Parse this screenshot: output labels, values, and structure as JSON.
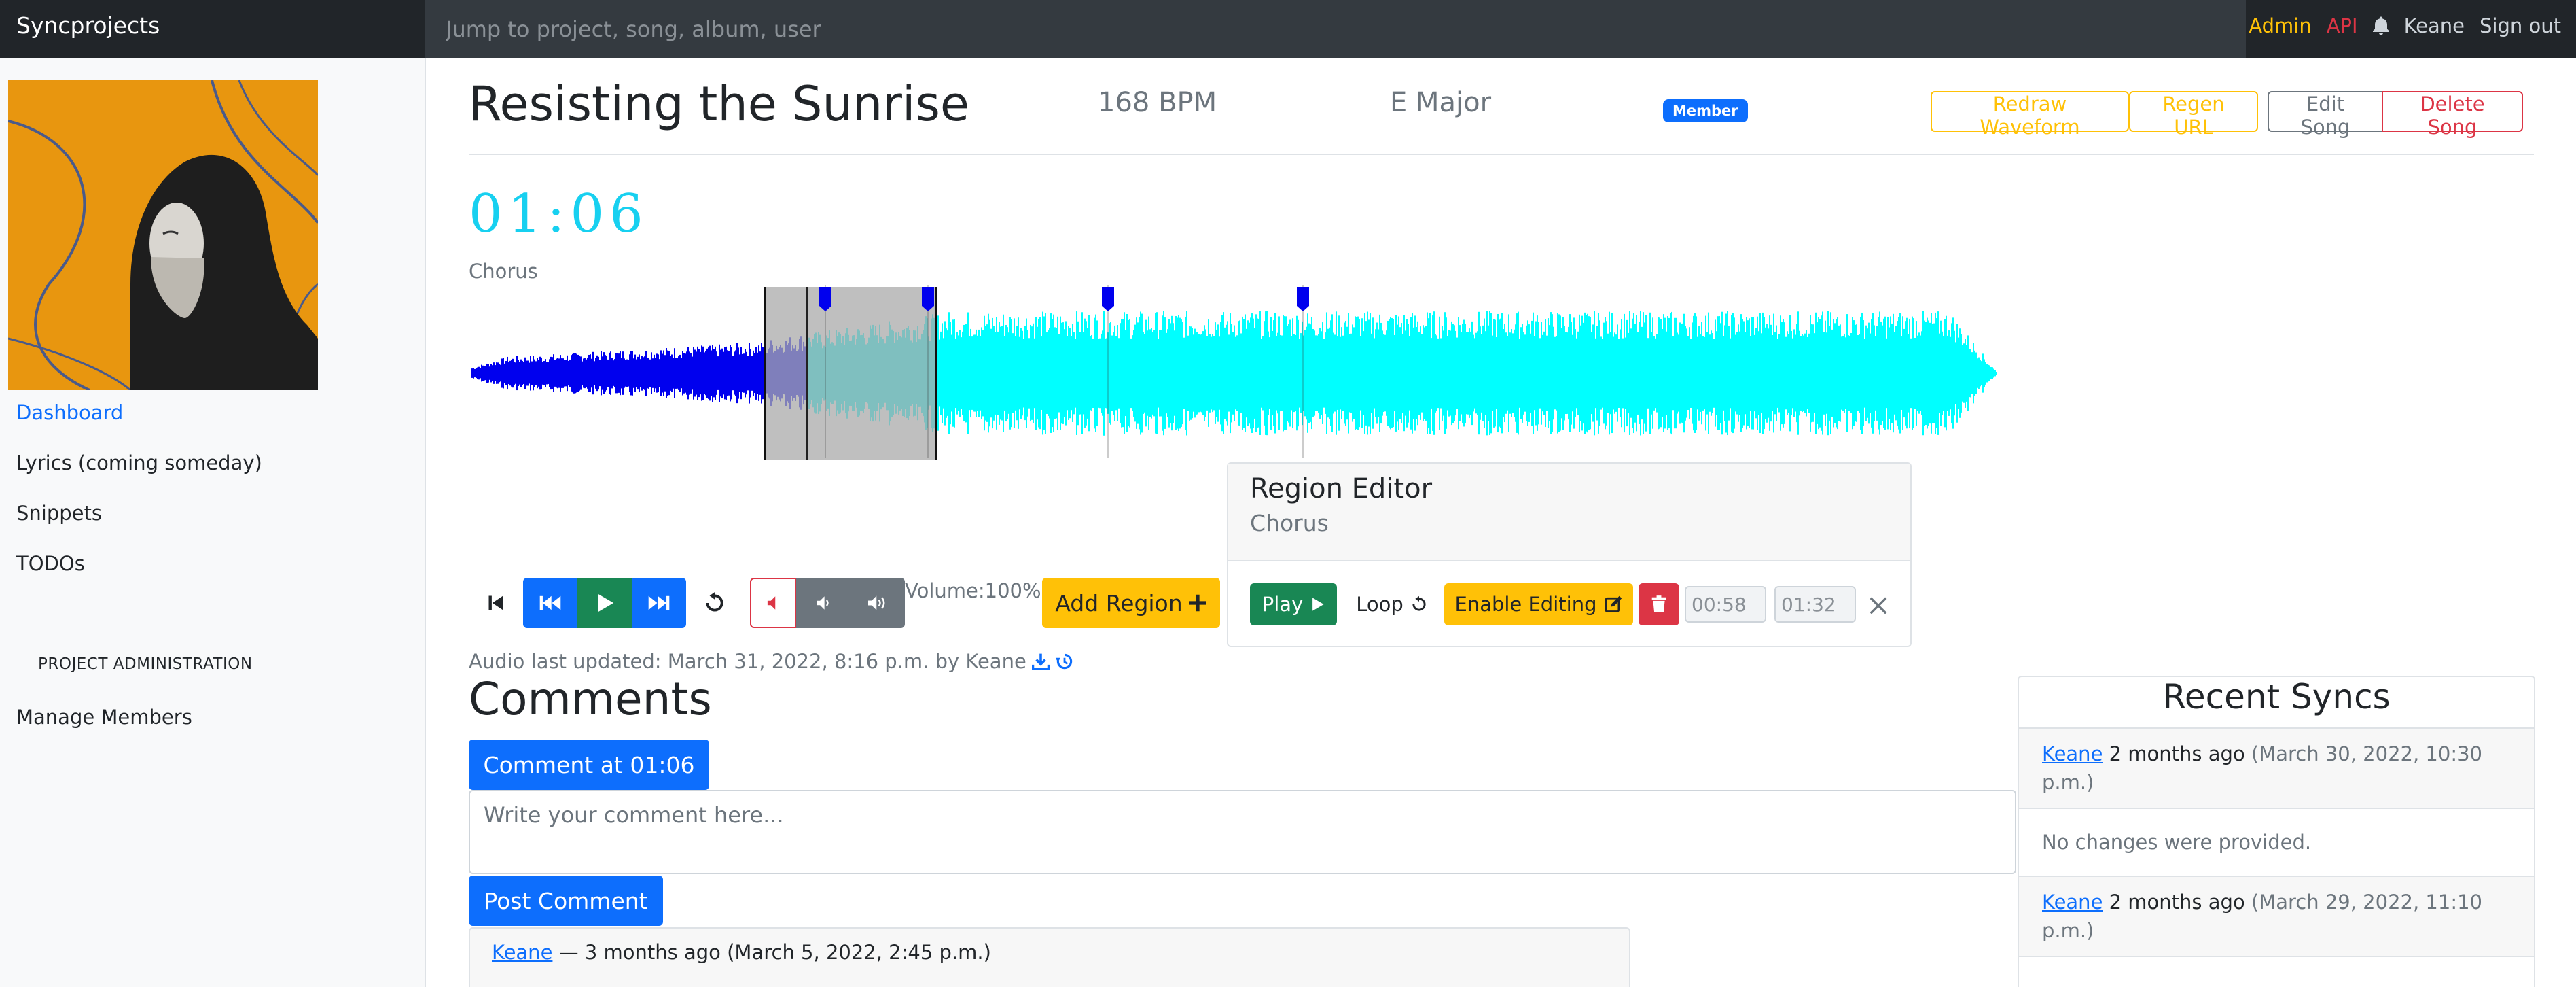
{
  "nav": {
    "brand": "Syncprojects",
    "search_placeholder": "Jump to project, song, album, user",
    "admin": "Admin",
    "api": "API",
    "user": "Keane",
    "signout": "Sign out"
  },
  "sidebar": {
    "items": [
      {
        "label": "Dashboard"
      },
      {
        "label": "Lyrics (coming someday)"
      },
      {
        "label": "Snippets"
      },
      {
        "label": "TODOs"
      }
    ],
    "section_heading": "PROJECT ADMINISTRATION",
    "admin_items": [
      {
        "label": "Manage Members"
      }
    ]
  },
  "song": {
    "title": "Resisting the Sunrise",
    "bpm": "168 BPM",
    "key": "E Major",
    "badge": "Member"
  },
  "actions": {
    "redraw": "Redraw Waveform",
    "regen": "Regen URL",
    "edit": "Edit Song",
    "delete": "Delete Song"
  },
  "player": {
    "time": "01:06",
    "current_region": "Chorus",
    "volume_label": "Volume:100%",
    "volume": 1.0,
    "add_region": "Add Region"
  },
  "region_editor": {
    "title": "Region Editor",
    "subtitle": "Chorus",
    "play": "Play",
    "loop": "Loop",
    "enable_editing": "Enable Editing",
    "start": "00:58",
    "end": "01:32"
  },
  "audio_updated": "Audio last updated: March 31, 2022, 8:16 p.m. by Keane",
  "comments": {
    "heading": "Comments",
    "comment_at": "Comment at 01:06",
    "placeholder": "Write your comment here...",
    "post": "Post Comment",
    "items": [
      {
        "author": "Keane",
        "meta": " — 3 months ago (March 5, 2022, 2:45 p.m.)"
      }
    ]
  },
  "recent_syncs": {
    "heading": "Recent Syncs",
    "items": [
      {
        "author": "Keane",
        "when": "2 months ago",
        "date": "(March 30, 2022, 10:30 p.m.)",
        "body": "No changes were provided."
      },
      {
        "author": "Keane",
        "when": "2 months ago",
        "date": "(March 29, 2022, 11:10 p.m.)"
      }
    ]
  },
  "colors": {
    "wave_played": "#0000ee",
    "wave_unplayed": "#00ffff",
    "region_overlay": "#a9a9a9",
    "accent": "#0d6efd",
    "time": "#17d0f0"
  }
}
